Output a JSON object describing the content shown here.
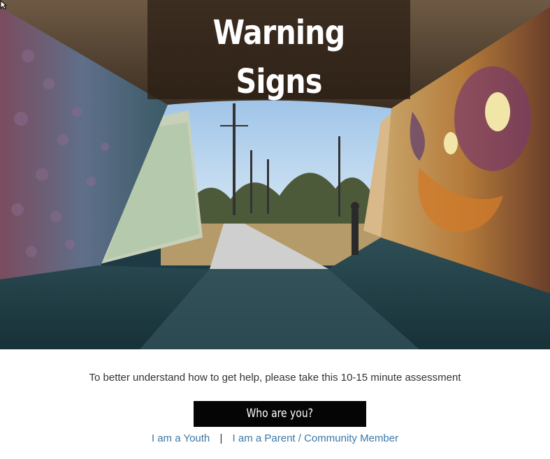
{
  "hero": {
    "title": "Warning Signs",
    "image_alt": "graffiti-covered tunnel opening onto a sunny path"
  },
  "assessment": {
    "intro_text": "To better understand how to get help, please take this 10-15 minute assessment",
    "button_label": "Who are you?",
    "links": [
      {
        "label": "I am a Youth"
      },
      {
        "label": "I am a Parent / Community Member"
      }
    ],
    "separator": "|"
  },
  "colors": {
    "link": "#3a78a8",
    "button_bg": "#050505",
    "title_box": "#281c12"
  }
}
